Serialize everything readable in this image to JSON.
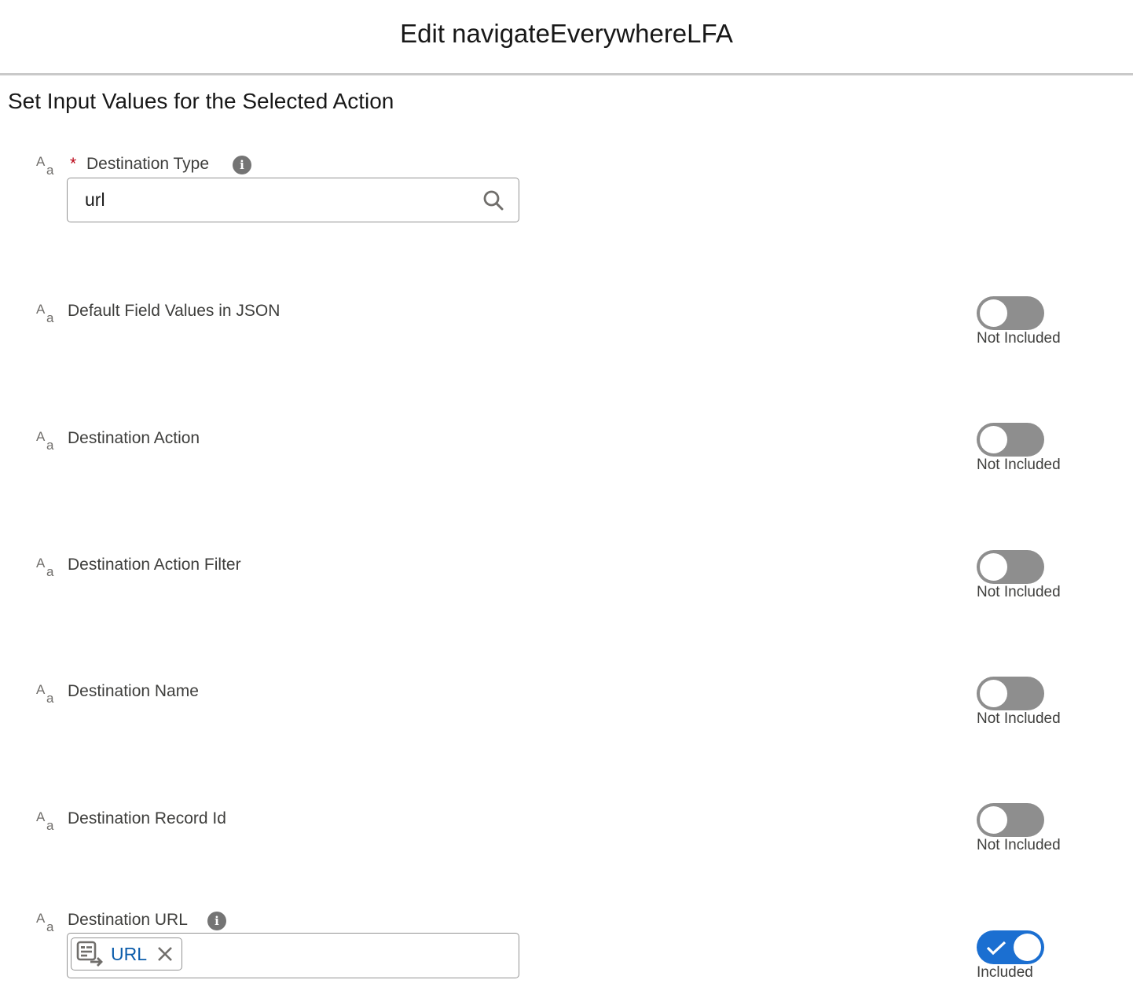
{
  "modal": {
    "title": "Edit navigateEverywhereLFA"
  },
  "section": {
    "title": "Set Input Values for the Selected Action"
  },
  "fields": {
    "destination_type": {
      "label": "Destination Type",
      "required_marker": "*",
      "info_icon": "info-icon",
      "value": "url",
      "search_icon": "search-icon",
      "type_icon": "text-type-icon"
    },
    "default_field_values": {
      "label": "Default Field Values in JSON",
      "status": "Not Included",
      "included": false
    },
    "destination_action": {
      "label": "Destination Action",
      "status": "Not Included",
      "included": false
    },
    "destination_action_filter": {
      "label": "Destination Action Filter",
      "status": "Not Included",
      "included": false
    },
    "destination_name": {
      "label": "Destination Name",
      "status": "Not Included",
      "included": false
    },
    "destination_record_id": {
      "label": "Destination Record Id",
      "status": "Not Included",
      "included": false
    },
    "destination_url": {
      "label": "Destination URL",
      "info_icon": "info-icon",
      "pill_label": "URL",
      "pill_icon": "variable-resource-icon",
      "remove_icon": "close-icon",
      "status": "Included",
      "included": true
    }
  },
  "colors": {
    "toggle_off": "#8e8e8e",
    "toggle_on": "#1b6fd1",
    "required": "#ba0517",
    "pill_text": "#0b5cab"
  }
}
